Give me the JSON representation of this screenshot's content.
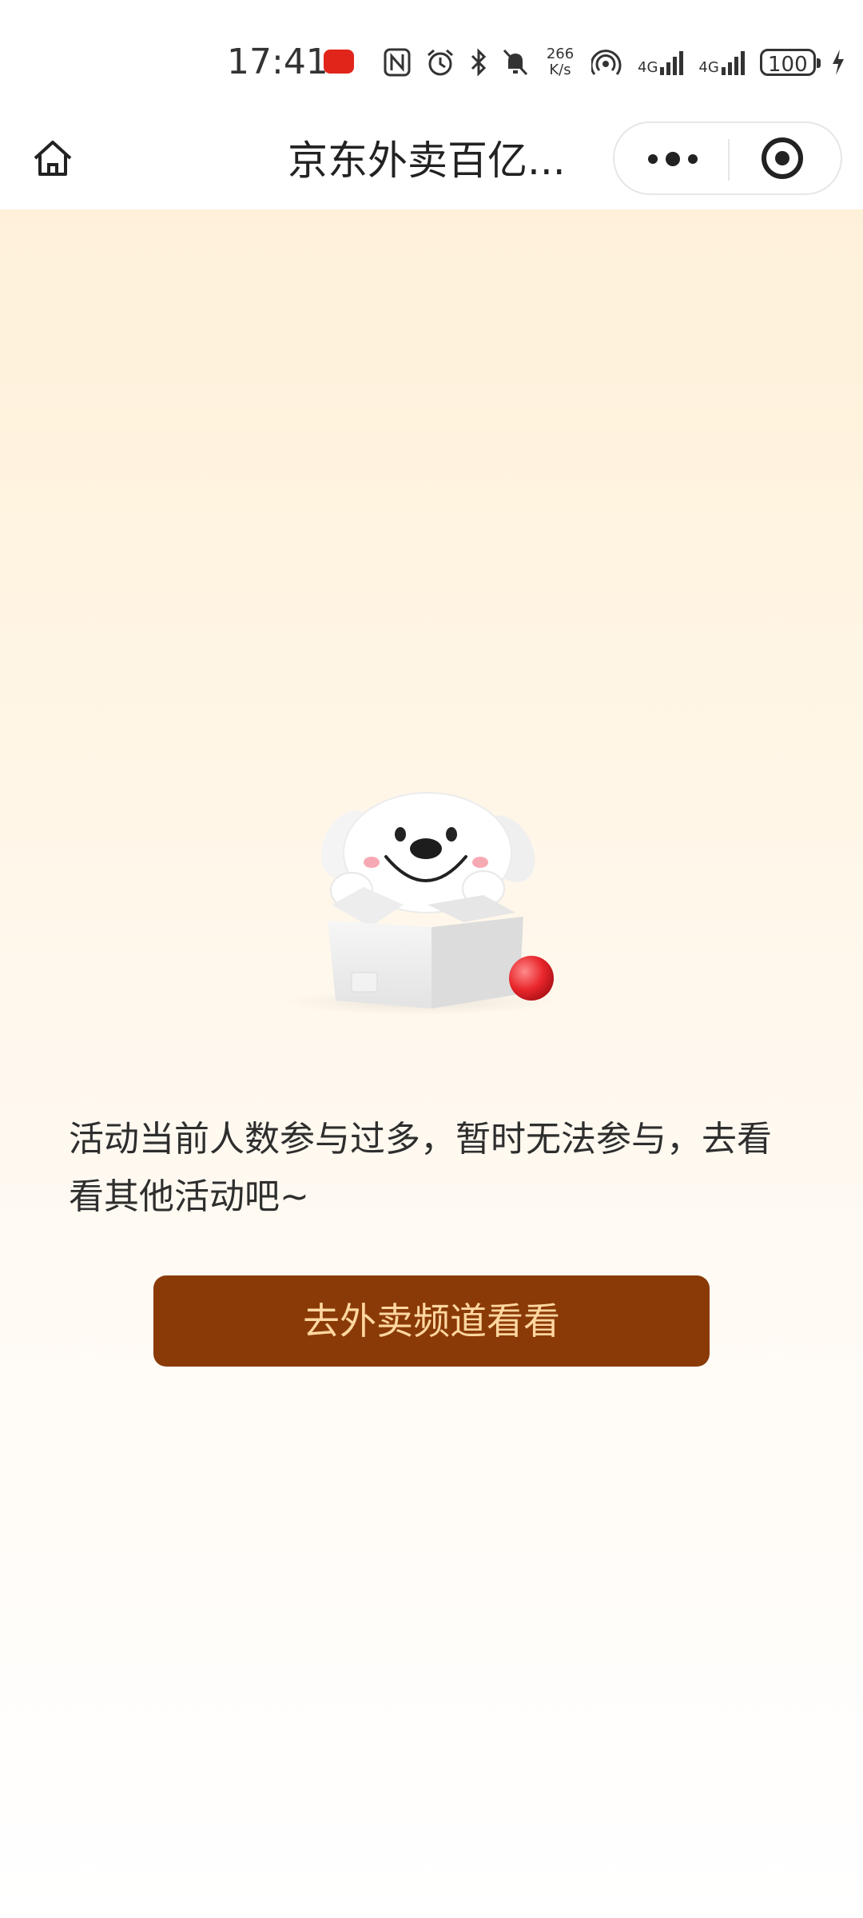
{
  "status_bar": {
    "time": "17:41",
    "net_speed_value": "266",
    "net_speed_unit": "K/s",
    "network_1": "4G",
    "network_2": "4G",
    "battery_level": "100",
    "icons": [
      "app-notification-icon",
      "nfc-icon",
      "alarm-icon",
      "bluetooth-icon",
      "mute-icon",
      "hotspot-icon",
      "signal-icon",
      "signal-icon",
      "battery-icon",
      "charging-icon"
    ]
  },
  "title_bar": {
    "title": "京东外卖百亿...",
    "icons": [
      "home-icon",
      "more-icon",
      "close-target-icon"
    ]
  },
  "main": {
    "message": "活动当前人数参与过多，暂时无法参与，去看看其他活动吧~",
    "button_label": "去外卖频道看看",
    "colors": {
      "button_bg": "#8a3a07",
      "button_text": "#ffd7a0",
      "background_top": "#fff1d9"
    }
  }
}
